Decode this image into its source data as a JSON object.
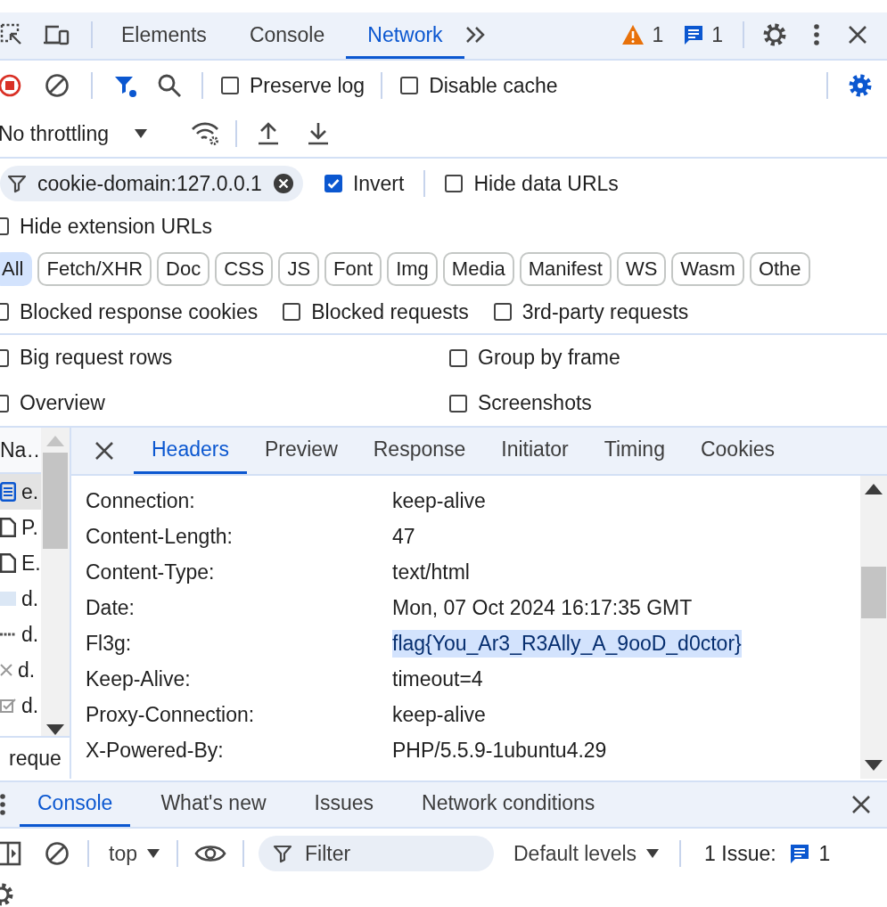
{
  "main_tabs": [
    {
      "label": "Elements",
      "selected": false
    },
    {
      "label": "Console",
      "selected": false
    },
    {
      "label": "Network",
      "selected": true
    }
  ],
  "counters": [
    {
      "kind": "warning",
      "count": "1"
    },
    {
      "kind": "message",
      "count": "1"
    }
  ],
  "toolbar": {
    "recording": true,
    "checkboxes": [
      {
        "label": "Preserve log",
        "checked": false
      },
      {
        "label": "Disable cache",
        "checked": false
      }
    ]
  },
  "throttling": "No throttling",
  "filter": {
    "value": "cookie-domain:127.0.0.1"
  },
  "filter_options": [
    {
      "label": "Invert",
      "checked": true
    },
    {
      "label": "Hide data URLs",
      "checked": false
    },
    {
      "label": "Hide extension URLs",
      "checked": false
    }
  ],
  "type_filters": [
    {
      "label": "All",
      "selected": true
    },
    {
      "label": "Fetch/XHR",
      "selected": false
    },
    {
      "label": "Doc",
      "selected": false
    },
    {
      "label": "CSS",
      "selected": false
    },
    {
      "label": "JS",
      "selected": false
    },
    {
      "label": "Font",
      "selected": false
    },
    {
      "label": "Img",
      "selected": false
    },
    {
      "label": "Media",
      "selected": false
    },
    {
      "label": "Manifest",
      "selected": false
    },
    {
      "label": "WS",
      "selected": false
    },
    {
      "label": "Wasm",
      "selected": false
    },
    {
      "label": "Othe",
      "selected": false
    }
  ],
  "more_filters": [
    {
      "label": "Blocked response cookies",
      "checked": false
    },
    {
      "label": "Blocked requests",
      "checked": false
    },
    {
      "label": "3rd-party requests",
      "checked": false
    }
  ],
  "settings": [
    {
      "label": "Big request rows",
      "checked": false
    },
    {
      "label": "Group by frame",
      "checked": false
    },
    {
      "label": "Overview",
      "checked": false
    },
    {
      "label": "Screenshots",
      "checked": false
    }
  ],
  "requests": {
    "column": "Na…",
    "summary": "reque",
    "rows": [
      {
        "name": "e.",
        "kind": "document",
        "selected": true
      },
      {
        "name": "P.",
        "kind": "file",
        "selected": false
      },
      {
        "name": "E.",
        "kind": "file",
        "selected": false
      },
      {
        "name": "d.",
        "kind": "image",
        "selected": false
      },
      {
        "name": "d.",
        "kind": "dots",
        "selected": false
      },
      {
        "name": "d.",
        "kind": "cross",
        "selected": false
      },
      {
        "name": "d.",
        "kind": "check",
        "selected": false
      }
    ]
  },
  "detail_tabs": [
    {
      "label": "Headers",
      "selected": true
    },
    {
      "label": "Preview",
      "selected": false
    },
    {
      "label": "Response",
      "selected": false
    },
    {
      "label": "Initiator",
      "selected": false
    },
    {
      "label": "Timing",
      "selected": false
    },
    {
      "label": "Cookies",
      "selected": false
    }
  ],
  "headers": [
    {
      "name": "Connection:",
      "value": "keep-alive",
      "selected": false
    },
    {
      "name": "Content-Length:",
      "value": "47",
      "selected": false
    },
    {
      "name": "Content-Type:",
      "value": "text/html",
      "selected": false
    },
    {
      "name": "Date:",
      "value": "Mon, 07 Oct 2024 16:17:35 GMT",
      "selected": false
    },
    {
      "name": "Fl3g:",
      "value": "flag{You_Ar3_R3Ally_A_9ooD_d0ctor}",
      "selected": true
    },
    {
      "name": "Keep-Alive:",
      "value": "timeout=4",
      "selected": false
    },
    {
      "name": "Proxy-Connection:",
      "value": "keep-alive",
      "selected": false
    },
    {
      "name": "X-Powered-By:",
      "value": "PHP/5.5.9-1ubuntu4.29",
      "selected": false
    }
  ],
  "drawer": {
    "tabs": [
      {
        "label": "Console",
        "selected": true
      },
      {
        "label": "What's new",
        "selected": false
      },
      {
        "label": "Issues",
        "selected": false
      },
      {
        "label": "Network conditions",
        "selected": false
      }
    ],
    "context": "top",
    "filter_placeholder": "Filter",
    "levels": "Default levels",
    "issues_label": "1 Issue:",
    "issues_count": "1"
  }
}
